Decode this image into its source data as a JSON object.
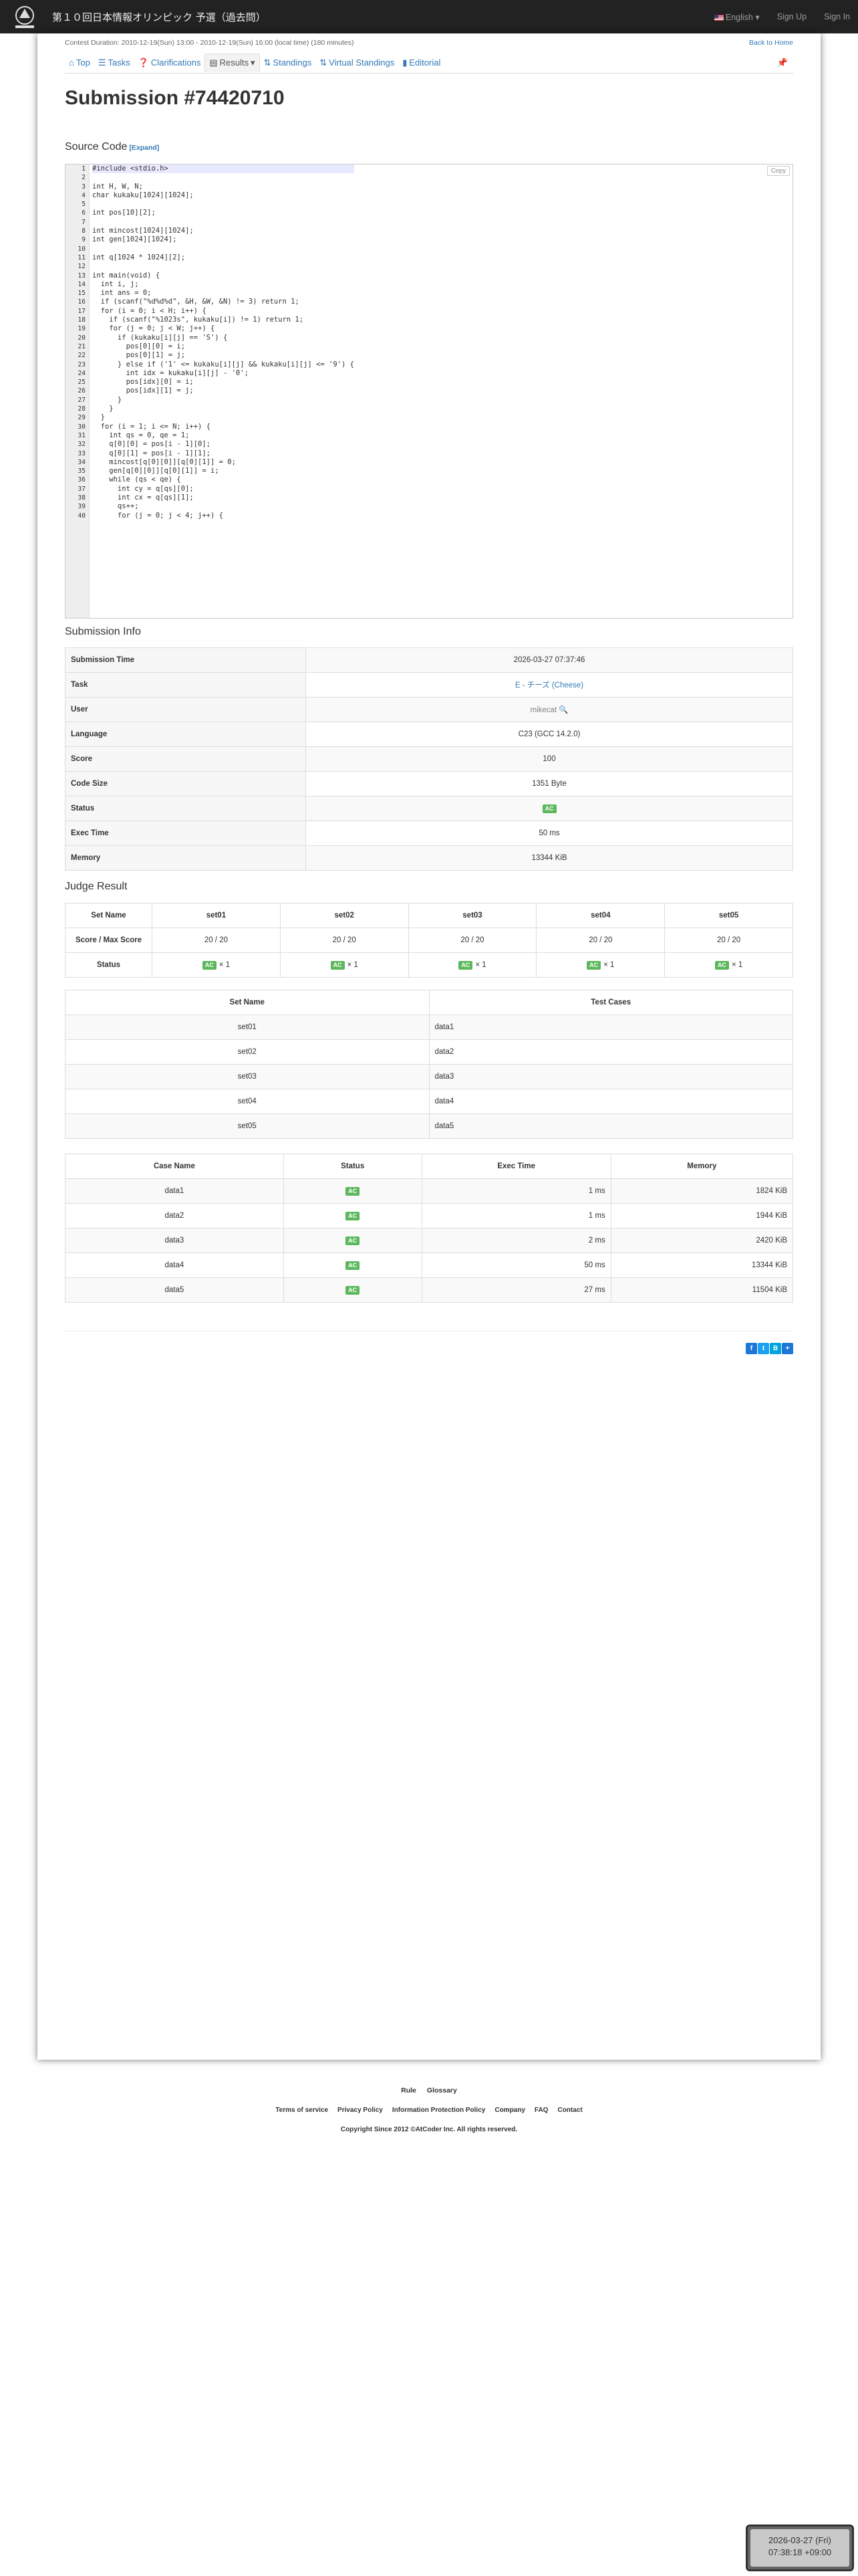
{
  "nav": {
    "brand": "第１０回日本情報オリンピック 予選（過去問）",
    "language": "English",
    "sign_up": "Sign Up",
    "sign_in": "Sign In"
  },
  "contest": {
    "duration": "Contest Duration: 2010-12-19(Sun) 13:00 - 2010-12-19(Sun) 16:00 (local time) (180 minutes)",
    "back": "Back to Home"
  },
  "tabs": {
    "top": "Top",
    "tasks": "Tasks",
    "clarifications": "Clarifications",
    "results": "Results",
    "standings": "Standings",
    "virtual": "Virtual Standings",
    "editorial": "Editorial"
  },
  "title": "Submission #74420710",
  "source": {
    "heading": "Source Code",
    "expand": "[Expand]",
    "copy": "Copy"
  },
  "code_lines": [
    "#include <stdio.h>",
    "",
    "int H, W, N;",
    "char kukaku[1024][1024];",
    "",
    "int pos[10][2];",
    "",
    "int mincost[1024][1024];",
    "int gen[1024][1024];",
    "",
    "int q[1024 * 1024][2];",
    "",
    "int main(void) {",
    "  int i, j;",
    "  int ans = 0;",
    "  if (scanf(\"%d%d%d\", &H, &W, &N) != 3) return 1;",
    "  for (i = 0; i < H; i++) {",
    "    if (scanf(\"%1023s\", kukaku[i]) != 1) return 1;",
    "    for (j = 0; j < W; j++) {",
    "      if (kukaku[i][j] == 'S') {",
    "        pos[0][0] = i;",
    "        pos[0][1] = j;",
    "      } else if ('1' <= kukaku[i][j] && kukaku[i][j] <= '9') {",
    "        int idx = kukaku[i][j] - '0';",
    "        pos[idx][0] = i;",
    "        pos[idx][1] = j;",
    "      }",
    "    }",
    "  }",
    "  for (i = 1; i <= N; i++) {",
    "    int qs = 0, qe = 1;",
    "    q[0][0] = pos[i - 1][0];",
    "    q[0][1] = pos[i - 1][1];",
    "    mincost[q[0][0]][q[0][1]] = 0;",
    "    gen[q[0][0]][q[0][1]] = i;",
    "    while (qs < qe) {",
    "      int cy = q[qs][0];",
    "      int cx = q[qs][1];",
    "      qs++;",
    "      for (j = 0; j < 4; j++) {"
  ],
  "info": {
    "heading": "Submission Info",
    "rows": [
      {
        "label": "Submission Time",
        "value": "2026-03-27 07:37:46"
      },
      {
        "label": "Task",
        "value": "E - チーズ (Cheese)"
      },
      {
        "label": "User",
        "value": "mikecat"
      },
      {
        "label": "Language",
        "value": "C23 (GCC 14.2.0)"
      },
      {
        "label": "Score",
        "value": "100"
      },
      {
        "label": "Code Size",
        "value": "1351 Byte"
      },
      {
        "label": "Status",
        "value": "AC"
      },
      {
        "label": "Exec Time",
        "value": "50 ms"
      },
      {
        "label": "Memory",
        "value": "13344 KiB"
      }
    ]
  },
  "judge": {
    "heading": "Judge Result",
    "set_name": "Set Name",
    "score_max": "Score / Max Score",
    "status": "Status",
    "sets": [
      {
        "name": "set01",
        "score": "20 / 20",
        "status": "AC",
        "count": "× 1"
      },
      {
        "name": "set02",
        "score": "20 / 20",
        "status": "AC",
        "count": "× 1"
      },
      {
        "name": "set03",
        "score": "20 / 20",
        "status": "AC",
        "count": "× 1"
      },
      {
        "name": "set04",
        "score": "20 / 20",
        "status": "AC",
        "count": "× 1"
      },
      {
        "name": "set05",
        "score": "20 / 20",
        "status": "AC",
        "count": "× 1"
      }
    ],
    "map_headers": [
      "Set Name",
      "Test Cases"
    ],
    "map": [
      [
        "set01",
        "data1"
      ],
      [
        "set02",
        "data2"
      ],
      [
        "set03",
        "data3"
      ],
      [
        "set04",
        "data4"
      ],
      [
        "set05",
        "data5"
      ]
    ],
    "case_headers": [
      "Case Name",
      "Status",
      "Exec Time",
      "Memory"
    ],
    "cases": [
      {
        "name": "data1",
        "status": "AC",
        "time": "1 ms",
        "mem": "1824 KiB"
      },
      {
        "name": "data2",
        "status": "AC",
        "time": "1 ms",
        "mem": "1944 KiB"
      },
      {
        "name": "data3",
        "status": "AC",
        "time": "2 ms",
        "mem": "2420 KiB"
      },
      {
        "name": "data4",
        "status": "AC",
        "time": "50 ms",
        "mem": "13344 KiB"
      },
      {
        "name": "data5",
        "status": "AC",
        "time": "27 ms",
        "mem": "11504 KiB"
      }
    ]
  },
  "footer": {
    "row1": [
      "Rule",
      "Glossary"
    ],
    "row2": [
      "Terms of service",
      "Privacy Policy",
      "Information Protection Policy",
      "Company",
      "FAQ",
      "Contact"
    ],
    "copyright": "Copyright Since 2012 ©AtCoder Inc. All rights reserved."
  },
  "clock": {
    "date": "2026-03-27 (Fri)",
    "time": "07:38:18 +09:00"
  }
}
